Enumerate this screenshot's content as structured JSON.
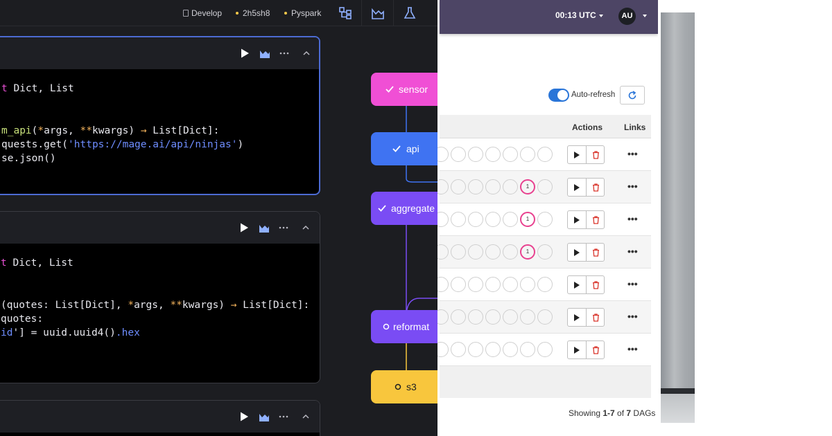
{
  "editor": {
    "topbar": {
      "branch_label": "Develop",
      "commit_label": "2h5sh8",
      "kernel_label": "Pyspark"
    },
    "blocks": [
      {
        "lines": [
          [
            "t Dict, List"
          ],
          [
            ""
          ],
          [
            ""
          ],
          [
            "m_api(*args, **kwargs) -> List[Dict]:"
          ],
          [
            "quests.get('https://mage.ai/api/ninjas')"
          ],
          [
            "se.json()"
          ]
        ]
      },
      {
        "lines": [
          [
            "t Dict, List"
          ],
          [
            ""
          ],
          [
            ""
          ],
          [
            "(quotes: List[Dict], *args, **kwargs) -> List[Dict]:"
          ],
          [
            "quotes:"
          ],
          [
            "id'] = uuid.uuid4().hex"
          ]
        ]
      }
    ]
  },
  "tree": {
    "nodes": [
      {
        "label": "sensor",
        "status": "done",
        "color": "#f04fd5"
      },
      {
        "label": "api",
        "status": "done",
        "color": "#3f73f2"
      },
      {
        "label": "aggregate",
        "status": "done",
        "color": "#7a4cf4"
      },
      {
        "label": "reformat",
        "status": "pending",
        "color": "#7a4cf4"
      },
      {
        "label": "s3",
        "status": "pending",
        "color": "#f8c63d"
      }
    ]
  },
  "airflow": {
    "time": "00:13 UTC",
    "user_initials": "AU",
    "auto_refresh_label": "Auto-refresh",
    "auto_refresh_on": true,
    "columns": {
      "actions": "Actions",
      "links": "Links"
    },
    "rows": [
      {
        "failed_count": null,
        "links": "•••"
      },
      {
        "failed_count": "1",
        "links": "•••"
      },
      {
        "failed_count": "1",
        "links": "•••"
      },
      {
        "failed_count": "1",
        "links": "•••"
      },
      {
        "failed_count": null,
        "links": "•••"
      },
      {
        "failed_count": null,
        "links": "•••"
      },
      {
        "failed_count": null,
        "links": "•••"
      }
    ],
    "showing": {
      "prefix": "Showing ",
      "range": "1-7",
      "of": " of ",
      "total": "7",
      "suffix": " DAGs"
    },
    "colors": {
      "header": "#4d4565",
      "failed": "#e8418f",
      "delete": "#d9342b",
      "toggle": "#2a75d8"
    }
  }
}
